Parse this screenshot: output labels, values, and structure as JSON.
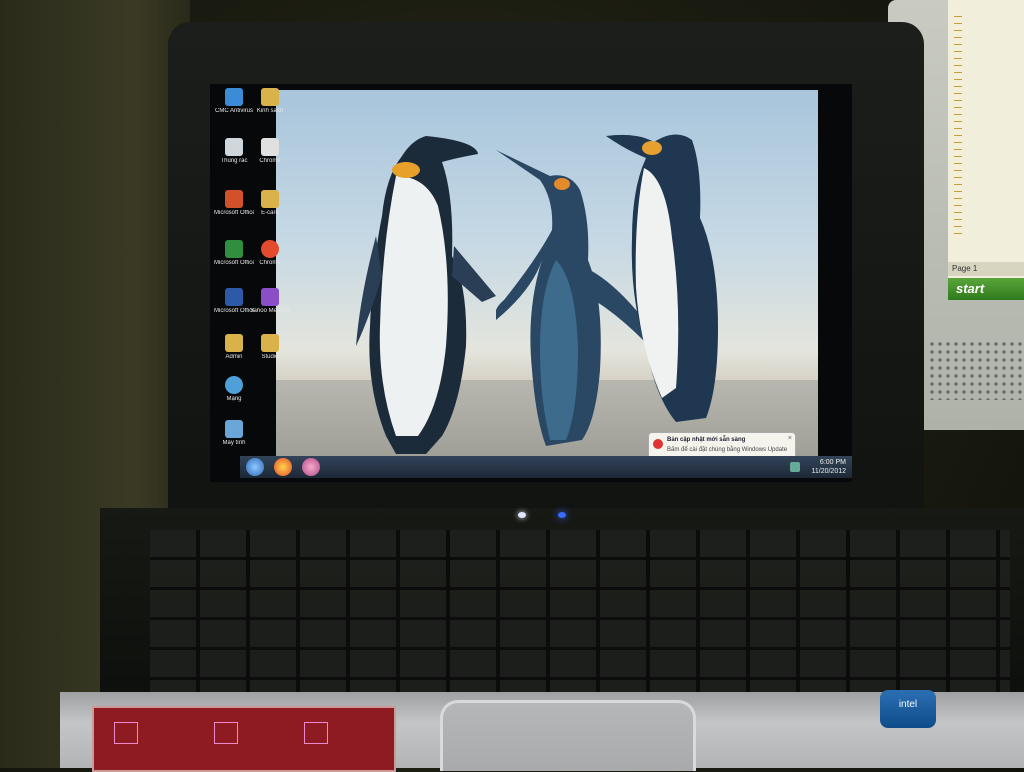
{
  "scene": {
    "external_monitor": {
      "status_text": "Page 1",
      "start_button": "start"
    },
    "laptop": {
      "desktop_icons": [
        {
          "label": "CMC Antivirus",
          "icon": "antivirus-icon",
          "color": "#3b8bd6"
        },
        {
          "label": "Kinh sach",
          "icon": "folder-icon",
          "color": "#d9b24a"
        },
        {
          "label": "Thùng rác",
          "icon": "recycle-bin-icon",
          "color": "#cfd6dc"
        },
        {
          "label": "Chrome",
          "icon": "document-icon",
          "color": "#e0e0e0"
        },
        {
          "label": "Microsoft Office Po...",
          "icon": "powerpoint-icon",
          "color": "#d2502a"
        },
        {
          "label": "E-card",
          "icon": "folder-icon",
          "color": "#d9b24a"
        },
        {
          "label": "Microsoft Office Ex...",
          "icon": "excel-icon",
          "color": "#2f8f3f"
        },
        {
          "label": "Chrome",
          "icon": "chrome-icon",
          "color": "#e24b2e"
        },
        {
          "label": "Microsoft Office Wo...",
          "icon": "word-icon",
          "color": "#2d5aa8"
        },
        {
          "label": "Yahoo Messenger",
          "icon": "messenger-icon",
          "color": "#8a4fc7"
        },
        {
          "label": "Admin",
          "icon": "folder-icon",
          "color": "#d9b24a"
        },
        {
          "label": "Studio",
          "icon": "folder-icon",
          "color": "#d9b24a"
        },
        {
          "label": "Mạng",
          "icon": "network-icon",
          "color": "#4fa0d8"
        },
        {
          "label": "Máy tính",
          "icon": "computer-icon",
          "color": "#6aa7d8"
        }
      ],
      "taskbar": {
        "start_icon": "windows-start-icon",
        "pinned": [
          "chrome-icon",
          "media-icon"
        ],
        "clock_time": "6:00 PM",
        "clock_date": "11/20/2012"
      },
      "notification": {
        "title": "Bản cập nhật mới sẵn sàng",
        "body": "Bấm để cài đặt chúng bằng Windows Update",
        "icon": "alert-icon"
      },
      "sticker_brand": "intel"
    },
    "colors": {
      "taskbar": "#1c2836",
      "wallpaper_sky": "#a8c5dc",
      "led_white": "#dfe8ff",
      "led_blue": "#3a6bff"
    }
  }
}
